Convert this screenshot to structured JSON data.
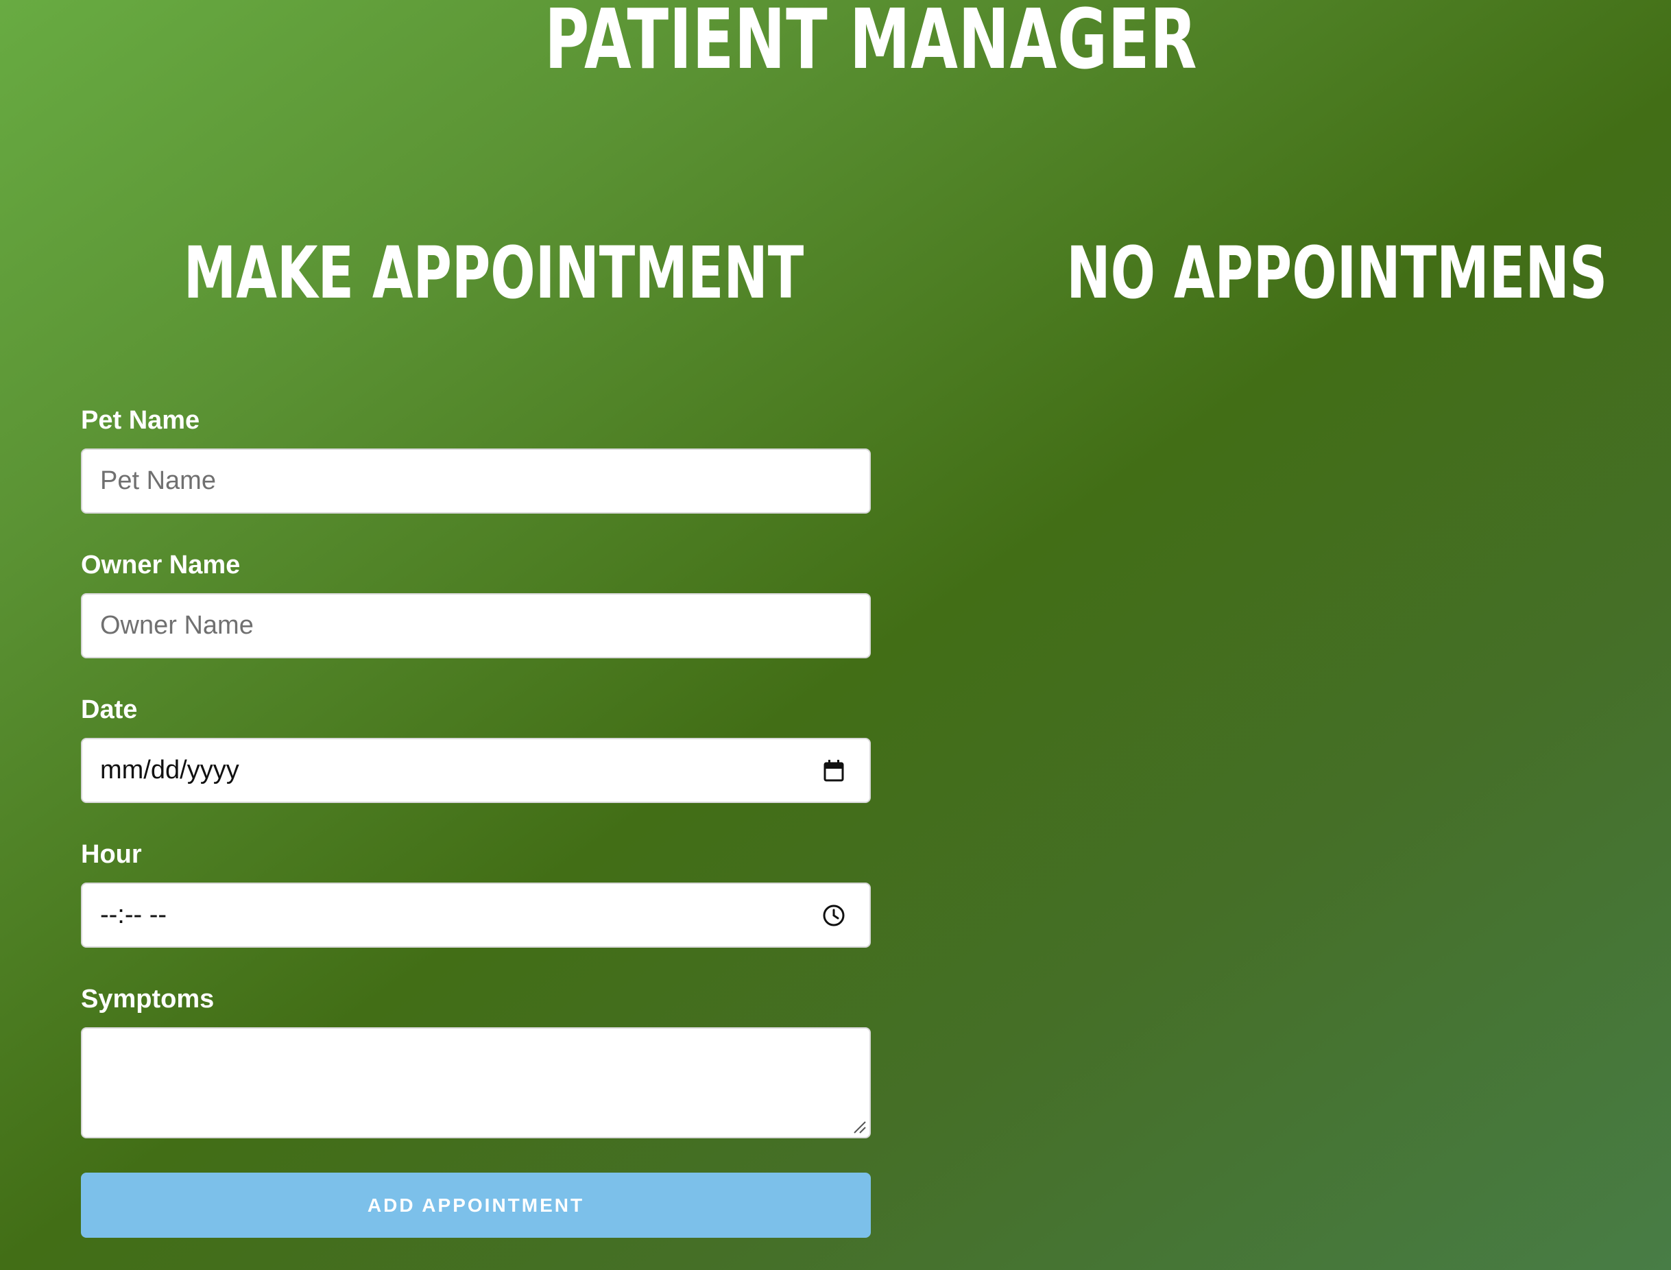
{
  "header": {
    "title": "PATIENT MANAGER"
  },
  "form": {
    "title": "MAKE APPOINTMENT",
    "fields": {
      "pet_name": {
        "label": "Pet Name",
        "placeholder": "Pet Name"
      },
      "owner_name": {
        "label": "Owner Name",
        "placeholder": "Owner Name"
      },
      "date": {
        "label": "Date",
        "value": "mm/dd/yyyy",
        "icon": "calendar-icon"
      },
      "hour": {
        "label": "Hour",
        "value": "--:-- --",
        "icon": "clock-icon"
      },
      "symptoms": {
        "label": "Symptoms",
        "value": ""
      }
    },
    "submit_label": "ADD APPOINTMENT"
  },
  "appointments": {
    "title": "NO APPOINTMENS"
  },
  "colors": {
    "background_start": "#68ab42",
    "background_mid": "#426e16",
    "background_end": "#487d46",
    "button": "#7cc0ea",
    "text": "#ffffff"
  }
}
